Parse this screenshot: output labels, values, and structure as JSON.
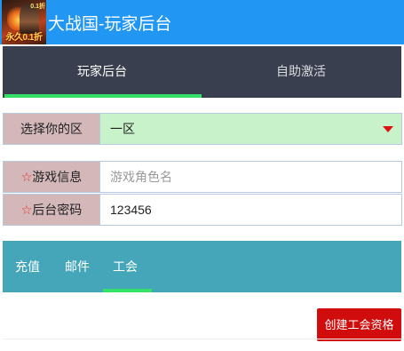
{
  "header": {
    "title": "大战国-玩家后台",
    "logo_text": "永久0.1折",
    "logo_tag": "0.1折"
  },
  "tabs": [
    {
      "label": "玩家后台",
      "active": true
    },
    {
      "label": "自助激活",
      "active": false
    }
  ],
  "form": {
    "server": {
      "label": "选择你的区",
      "selected": "一区"
    },
    "game_info": {
      "required_mark": "☆",
      "label": "游戏信息",
      "placeholder": "游戏角色名",
      "value": ""
    },
    "password": {
      "required_mark": "☆",
      "label": "后台密码",
      "value": "123456"
    }
  },
  "subnav": [
    {
      "label": "充值",
      "active": false
    },
    {
      "label": "邮件",
      "active": false
    },
    {
      "label": "工会",
      "active": true
    }
  ],
  "actions": {
    "create_guild_label": "创建工会资格"
  },
  "colors": {
    "header_bg": "#2196f3",
    "tabs_bg": "#3a3f4f",
    "active_underline": "#34e065",
    "label_bg": "#d3b7b9",
    "select_bg": "#c8f2ca",
    "subnav_bg": "#45a6ba",
    "button_bg": "#d00c0c"
  }
}
